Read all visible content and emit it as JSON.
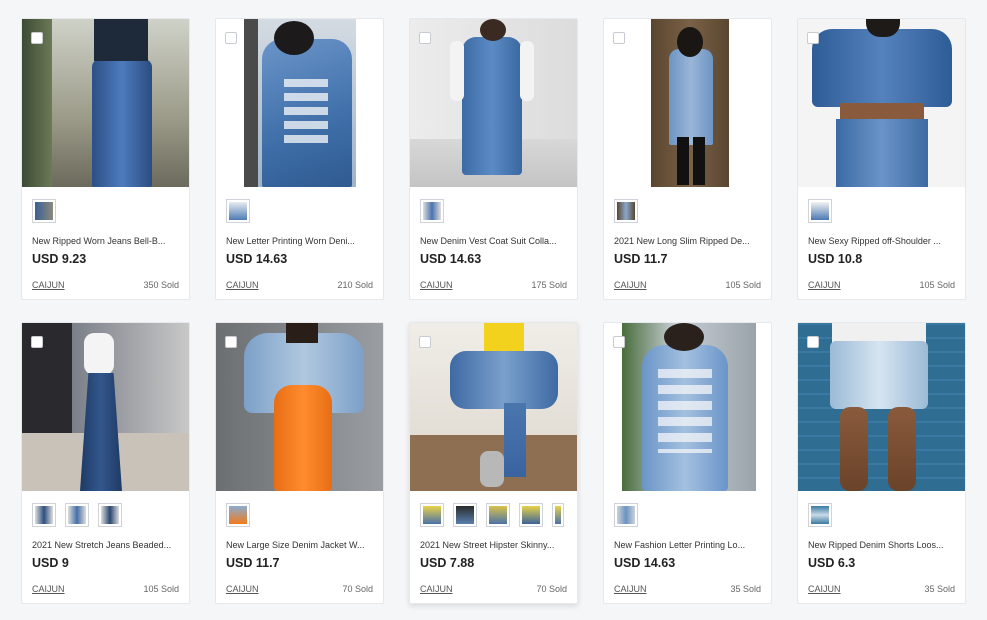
{
  "colors": {
    "page_background": "#f5f6f8",
    "card_background": "#ffffff",
    "text_primary": "#222222",
    "denim": "#3e6aa3"
  },
  "products": [
    {
      "title": "New Ripped Worn Jeans Bell-B...",
      "price": "USD 9.23",
      "seller": "CAIJUN",
      "sold": "350 Sold",
      "thumbnail_count": 1
    },
    {
      "title": "New Letter Printing Worn Deni...",
      "price": "USD 14.63",
      "seller": "CAIJUN",
      "sold": "210 Sold",
      "thumbnail_count": 1
    },
    {
      "title": "New Denim Vest Coat Suit Colla...",
      "price": "USD 14.63",
      "seller": "CAIJUN",
      "sold": "175 Sold",
      "thumbnail_count": 1
    },
    {
      "title": "2021 New Long Slim Ripped De...",
      "price": "USD 11.7",
      "seller": "CAIJUN",
      "sold": "105 Sold",
      "thumbnail_count": 1
    },
    {
      "title": "New Sexy Ripped off-Shoulder ...",
      "price": "USD 10.8",
      "seller": "CAIJUN",
      "sold": "105 Sold",
      "thumbnail_count": 1
    },
    {
      "title": "2021 New Stretch Jeans Beaded...",
      "price": "USD 9",
      "seller": "CAIJUN",
      "sold": "105 Sold",
      "thumbnail_count": 3
    },
    {
      "title": "New Large Size Denim Jacket W...",
      "price": "USD 11.7",
      "seller": "CAIJUN",
      "sold": "70 Sold",
      "thumbnail_count": 1
    },
    {
      "title": "2021 New Street Hipster Skinny...",
      "price": "USD 7.88",
      "seller": "CAIJUN",
      "sold": "70 Sold",
      "thumbnail_count": 5
    },
    {
      "title": "New Fashion Letter Printing Lo...",
      "price": "USD 14.63",
      "seller": "CAIJUN",
      "sold": "35 Sold",
      "thumbnail_count": 1
    },
    {
      "title": "New Ripped Denim Shorts Loos...",
      "price": "USD 6.3",
      "seller": "CAIJUN",
      "sold": "35 Sold",
      "thumbnail_count": 1
    }
  ]
}
